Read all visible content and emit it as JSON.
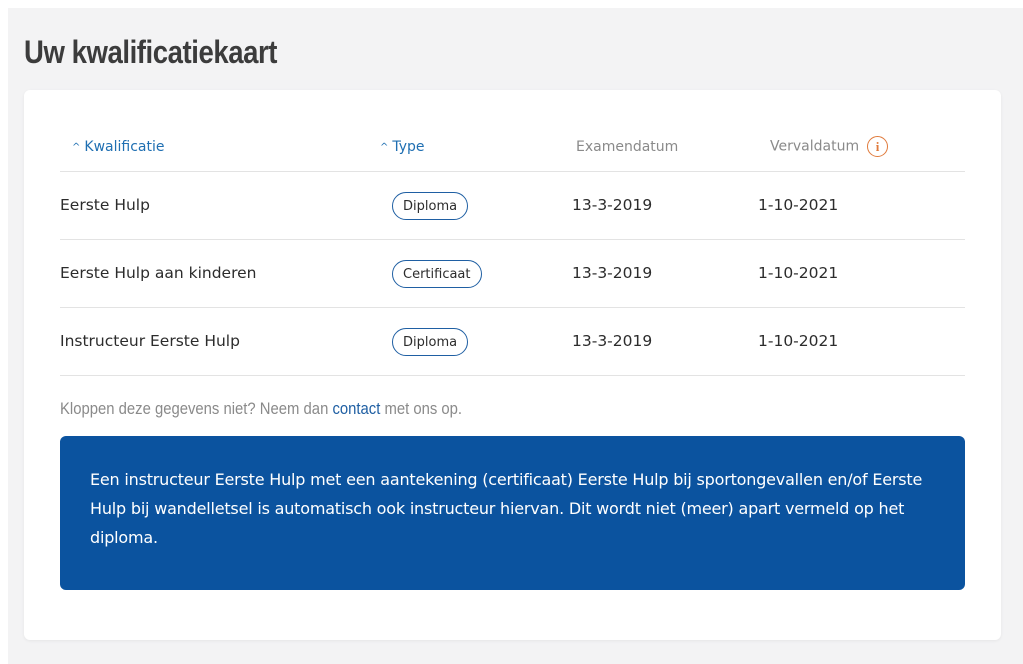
{
  "page": {
    "title": "Uw kwalificatiekaart"
  },
  "table": {
    "headers": {
      "qualification": "Kwalificatie",
      "type": "Type",
      "exam_date": "Examendatum",
      "expiry_date": "Vervaldatum"
    },
    "rows": [
      {
        "qualification": "Eerste Hulp",
        "type": "Diploma",
        "exam_date": "13-3-2019",
        "expiry_date": "1-10-2021"
      },
      {
        "qualification": "Eerste Hulp aan kinderen",
        "type": "Certificaat",
        "exam_date": "13-3-2019",
        "expiry_date": "1-10-2021"
      },
      {
        "qualification": "Instructeur Eerste Hulp",
        "type": "Diploma",
        "exam_date": "13-3-2019",
        "expiry_date": "1-10-2021"
      }
    ]
  },
  "icons": {
    "sort": "chevron-up-icon",
    "info": "info-icon"
  },
  "note": {
    "before": "Kloppen deze gegevens niet? Neem dan ",
    "link": "contact",
    "after": " met ons op."
  },
  "info_box": {
    "text": "Een instructeur Eerste Hulp met een aantekening (certificaat) Eerste Hulp bij sportongevallen en/of Eerste Hulp bij wandelletsel is automatisch ook instructeur hiervan. Dit wordt niet (meer) apart vermeld op het diploma."
  },
  "colors": {
    "page_bg": "#f3f3f4",
    "card_bg": "#ffffff",
    "link_blue": "#1f6fb2",
    "box_blue": "#0b539f",
    "info_orange": "#e07a3b",
    "title_gray": "#3c3c3c",
    "muted_gray": "#8a8a8a"
  }
}
